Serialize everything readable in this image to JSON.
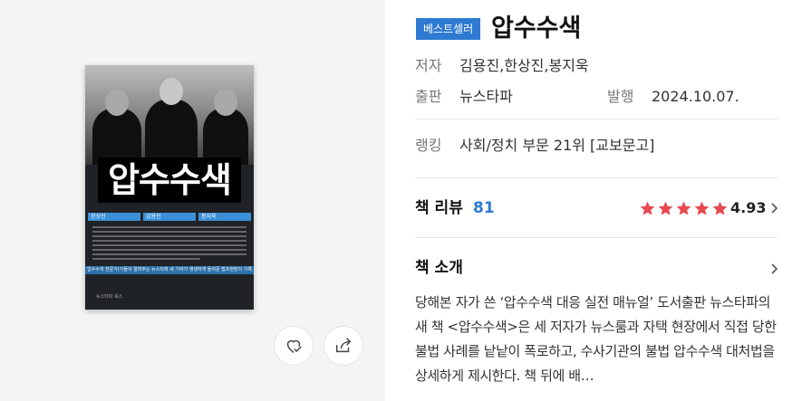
{
  "cover": {
    "title": "압수수색",
    "authors": [
      "한상진",
      "김용진",
      "봉지욱"
    ],
    "tagline": "압수수색 전문가(?)들이 알려주는 뉴스타파 세 기자가 생생하게 들려준 법조현장의 기록",
    "publisher_mark": "뉴스타파 북스"
  },
  "actions": {
    "wish_icon": "heart-check-icon",
    "share_icon": "share-icon"
  },
  "book": {
    "badge": "베스트셀러",
    "title": "압수수색",
    "author_label": "저자",
    "author_value": "김용진,한상진,봉지욱",
    "publisher_label": "출판",
    "publisher_value": "뉴스타파",
    "date_label": "발행",
    "date_value": "2024.10.07.",
    "ranking_label": "랭킹",
    "ranking_value": "사회/정치 부문 21위 [교보문고]"
  },
  "review": {
    "label": "책 리뷰",
    "count": "81",
    "rating": "4.93",
    "stars": 5
  },
  "intro": {
    "label": "책 소개",
    "text": "당해본 자가 쓴 ‘압수수색 대응 실전 매뉴얼’ 도서출판 뉴스타파의 새 책 <압수수색>은 세 저자가 뉴스룸과 자택 현장에서 직접 당한 불법 사례를 낱낱이 폭로하고, 수사기관의 불법 압수수색 대처법을 상세하게 제시한다. 책 뒤에 배…"
  },
  "colors": {
    "accent": "#2e7ad1",
    "star": "#e8484f"
  }
}
